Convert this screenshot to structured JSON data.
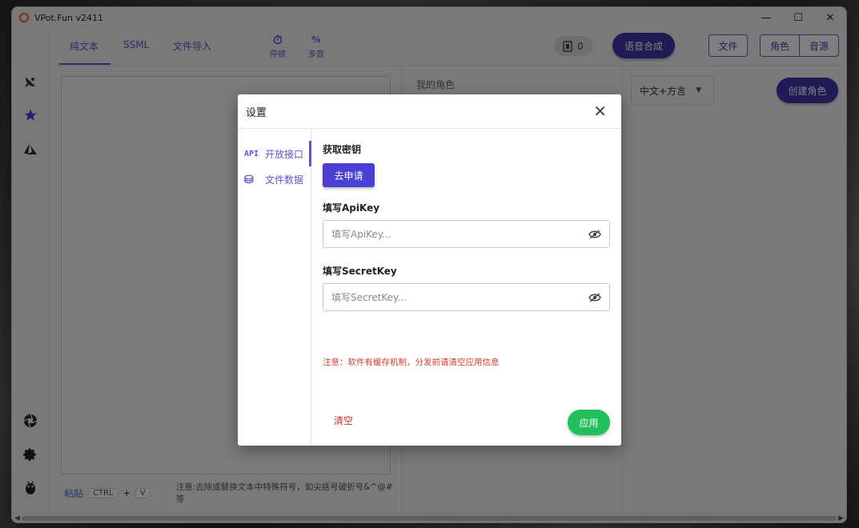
{
  "window": {
    "title": "VPot.Fun v2411",
    "minimize": "—",
    "maximize": "☐",
    "close": "✕"
  },
  "toolbar": {
    "tabs": [
      "纯文本",
      "SSML",
      "文件导入"
    ],
    "tools": [
      {
        "icon": "timer-icon",
        "glyph": "⏱",
        "label": "停顿"
      },
      {
        "icon": "polyphone-icon",
        "glyph": "⁸⁄₈",
        "label": "多音"
      }
    ],
    "counter": "0",
    "synthesize": "语音合成",
    "file": "文件",
    "role": "角色",
    "source": "音源"
  },
  "text_pane": {
    "paste": "粘贴",
    "key_ctrl": "CTRL",
    "key_plus": "+",
    "key_v": "V",
    "note": "注意:去除或替换文本中特殊符号，如尖括号破折号&^@#等"
  },
  "role_pane": {
    "title": "我的角色"
  },
  "right_pane": {
    "language": "中文+方言",
    "create_role": "创建角色"
  },
  "modal": {
    "title": "设置",
    "close": "✕",
    "side": [
      {
        "icon_text": "API",
        "label": "开放接口"
      },
      {
        "icon_text": "⛁",
        "label": "文件数据"
      }
    ],
    "get_key_label": "获取密钥",
    "apply_key_button": "去申请",
    "apikey_label": "填写ApiKey",
    "apikey_placeholder": "填写ApiKey...",
    "apikey_value": "",
    "secretkey_label": "填写SecretKey",
    "secretkey_placeholder": "填写SecretKey...",
    "secretkey_value": "",
    "warning": "注意：软件有缓存机制，分发前请清空应用信息",
    "clear": "清空",
    "apply": "应用"
  },
  "colors": {
    "accent": "#6a4dd6",
    "primary_button": "#3f37a8",
    "apply_green": "#22c05b",
    "warning_red": "#d63b2f"
  }
}
